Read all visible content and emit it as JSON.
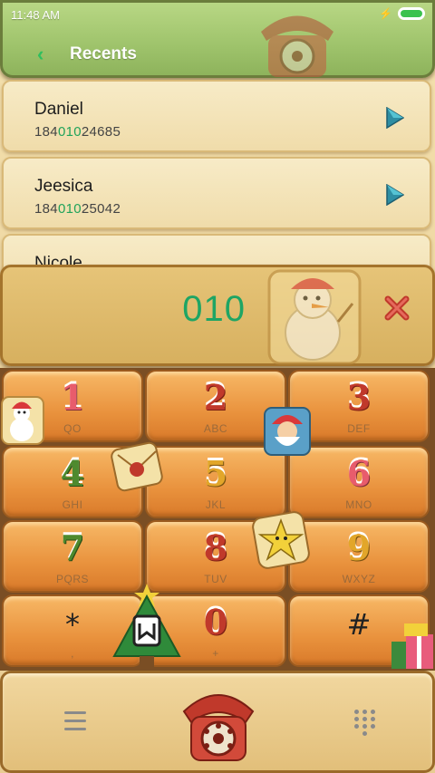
{
  "status_bar": {
    "time": "11:48 AM"
  },
  "header": {
    "title": "Recents",
    "back_icon": "chevron-left-icon"
  },
  "recents": [
    {
      "name": "Daniel",
      "number_prefix": "184",
      "number_match": "010",
      "number_suffix": "24685"
    },
    {
      "name": "Jeesica",
      "number_prefix": "184",
      "number_match": "010",
      "number_suffix": "25042"
    },
    {
      "name": "Nicole",
      "number_prefix": "",
      "number_match": "",
      "number_suffix": ""
    }
  ],
  "dial": {
    "number": "010"
  },
  "keypad": {
    "keys": [
      {
        "digit": "1",
        "letters": "QO"
      },
      {
        "digit": "2",
        "letters": "ABC"
      },
      {
        "digit": "3",
        "letters": "DEF"
      },
      {
        "digit": "4",
        "letters": "GHI"
      },
      {
        "digit": "5",
        "letters": "JKL"
      },
      {
        "digit": "6",
        "letters": "MNO"
      },
      {
        "digit": "7",
        "letters": "PQRS"
      },
      {
        "digit": "8",
        "letters": "TUV"
      },
      {
        "digit": "9",
        "letters": "WXYZ"
      },
      {
        "digit": "*",
        "letters": ","
      },
      {
        "digit": "0",
        "letters": "+"
      },
      {
        "digit": "#",
        "letters": ""
      }
    ]
  },
  "colors": {
    "accent_green": "#20a35a",
    "header_green": "#9ec36b",
    "delete_red": "#c0392b"
  }
}
